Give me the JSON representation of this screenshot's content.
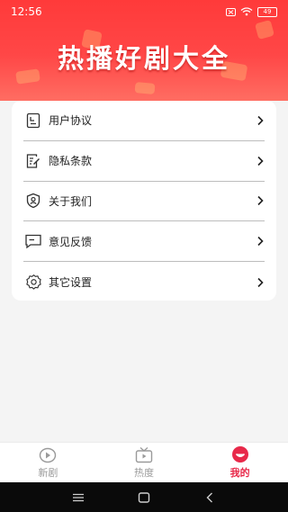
{
  "status_bar": {
    "time": "12:56",
    "battery": "49"
  },
  "banner": {
    "title": "热播好剧大全"
  },
  "menu": {
    "items": [
      {
        "label": "用户协议",
        "icon": "document-icon"
      },
      {
        "label": "隐私条款",
        "icon": "privacy-edit-icon"
      },
      {
        "label": "关于我们",
        "icon": "shield-user-icon"
      },
      {
        "label": "意见反馈",
        "icon": "message-icon"
      },
      {
        "label": "其它设置",
        "icon": "gear-icon"
      }
    ]
  },
  "tabbar": {
    "tabs": [
      {
        "label": "新剧",
        "icon": "play-circle-icon",
        "active": false
      },
      {
        "label": "热度",
        "icon": "tv-icon",
        "active": false
      },
      {
        "label": "我的",
        "icon": "profile-icon",
        "active": true
      }
    ]
  },
  "colors": {
    "accent": "#e8294a",
    "banner": "#ff3a3a"
  }
}
